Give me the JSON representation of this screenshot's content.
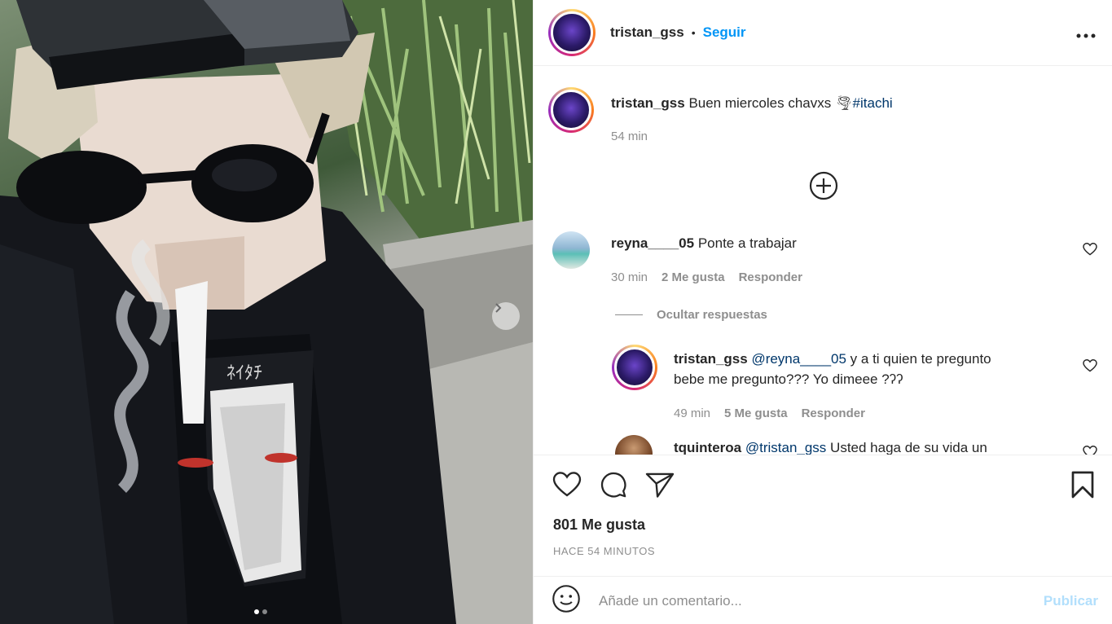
{
  "post": {
    "author": "tristan_gss",
    "follow_label": "Seguir",
    "separator": "•",
    "more_label": "•••"
  },
  "caption": {
    "author": "tristan_gss",
    "text": "Buen miercoles chavxs 🌪",
    "hashtag": "#itachi",
    "time": "54 min"
  },
  "load_more_icon": "plus-circle-icon",
  "comments": [
    {
      "author": "reyna____05",
      "text": "Ponte a trabajar",
      "time": "30 min",
      "likes": "2 Me gusta",
      "reply": "Responder"
    }
  ],
  "hide_replies": "Ocultar respuestas",
  "replies": [
    {
      "author": "tristan_gss",
      "mention": "@reyna____05",
      "text_line1": " y a ti quien te pregunto",
      "text_line2": "bebe me pregunto??? Yo dimeee ?ʔʔ",
      "time": "49 min",
      "likes": "5 Me gusta",
      "reply": "Responder"
    },
    {
      "author": "tquinteroa",
      "mention": "@tristan_gss",
      "text": " Usted haga de su vida un"
    }
  ],
  "actions": {
    "like_icon": "heart-icon",
    "comment_icon": "comment-icon",
    "share_icon": "send-icon",
    "save_icon": "bookmark-icon"
  },
  "likes_count": "801 Me gusta",
  "posted_ago": "HACE 54 MINUTOS",
  "comment_box": {
    "placeholder": "Añade un comentario...",
    "publish_label": "Publicar",
    "emoji_icon": "smiley-icon"
  },
  "carousel": {
    "next_icon": "chevron-right-icon",
    "current": 1,
    "total": 2
  }
}
